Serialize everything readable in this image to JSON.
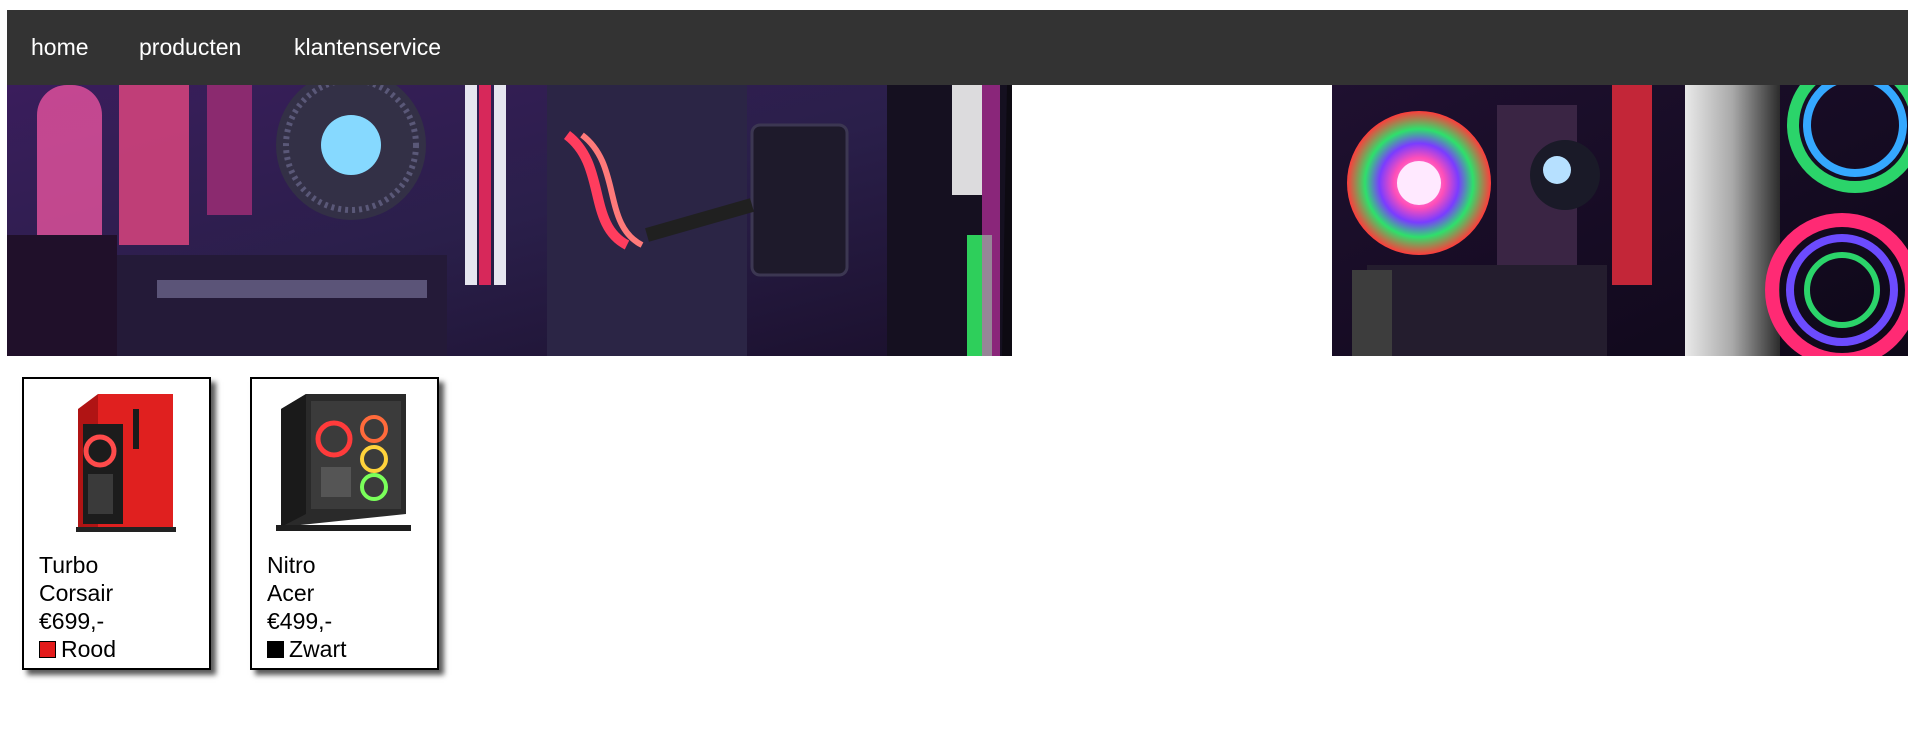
{
  "nav": {
    "items": [
      {
        "label": "home"
      },
      {
        "label": "producten"
      },
      {
        "label": "klantenservice"
      }
    ]
  },
  "banner": {
    "image_subject": "pc-interior-rgb-lighting"
  },
  "products": [
    {
      "line1": "Turbo",
      "line2": "Corsair",
      "price": "€699,-",
      "color_label": "Rood",
      "color_hex": "#e31b1b",
      "image_subject": "red-pc-case"
    },
    {
      "line1": "Nitro",
      "line2": "Acer",
      "price": "€499,-",
      "color_label": "Zwart",
      "color_hex": "#000000",
      "image_subject": "black-glass-pc-case"
    }
  ]
}
